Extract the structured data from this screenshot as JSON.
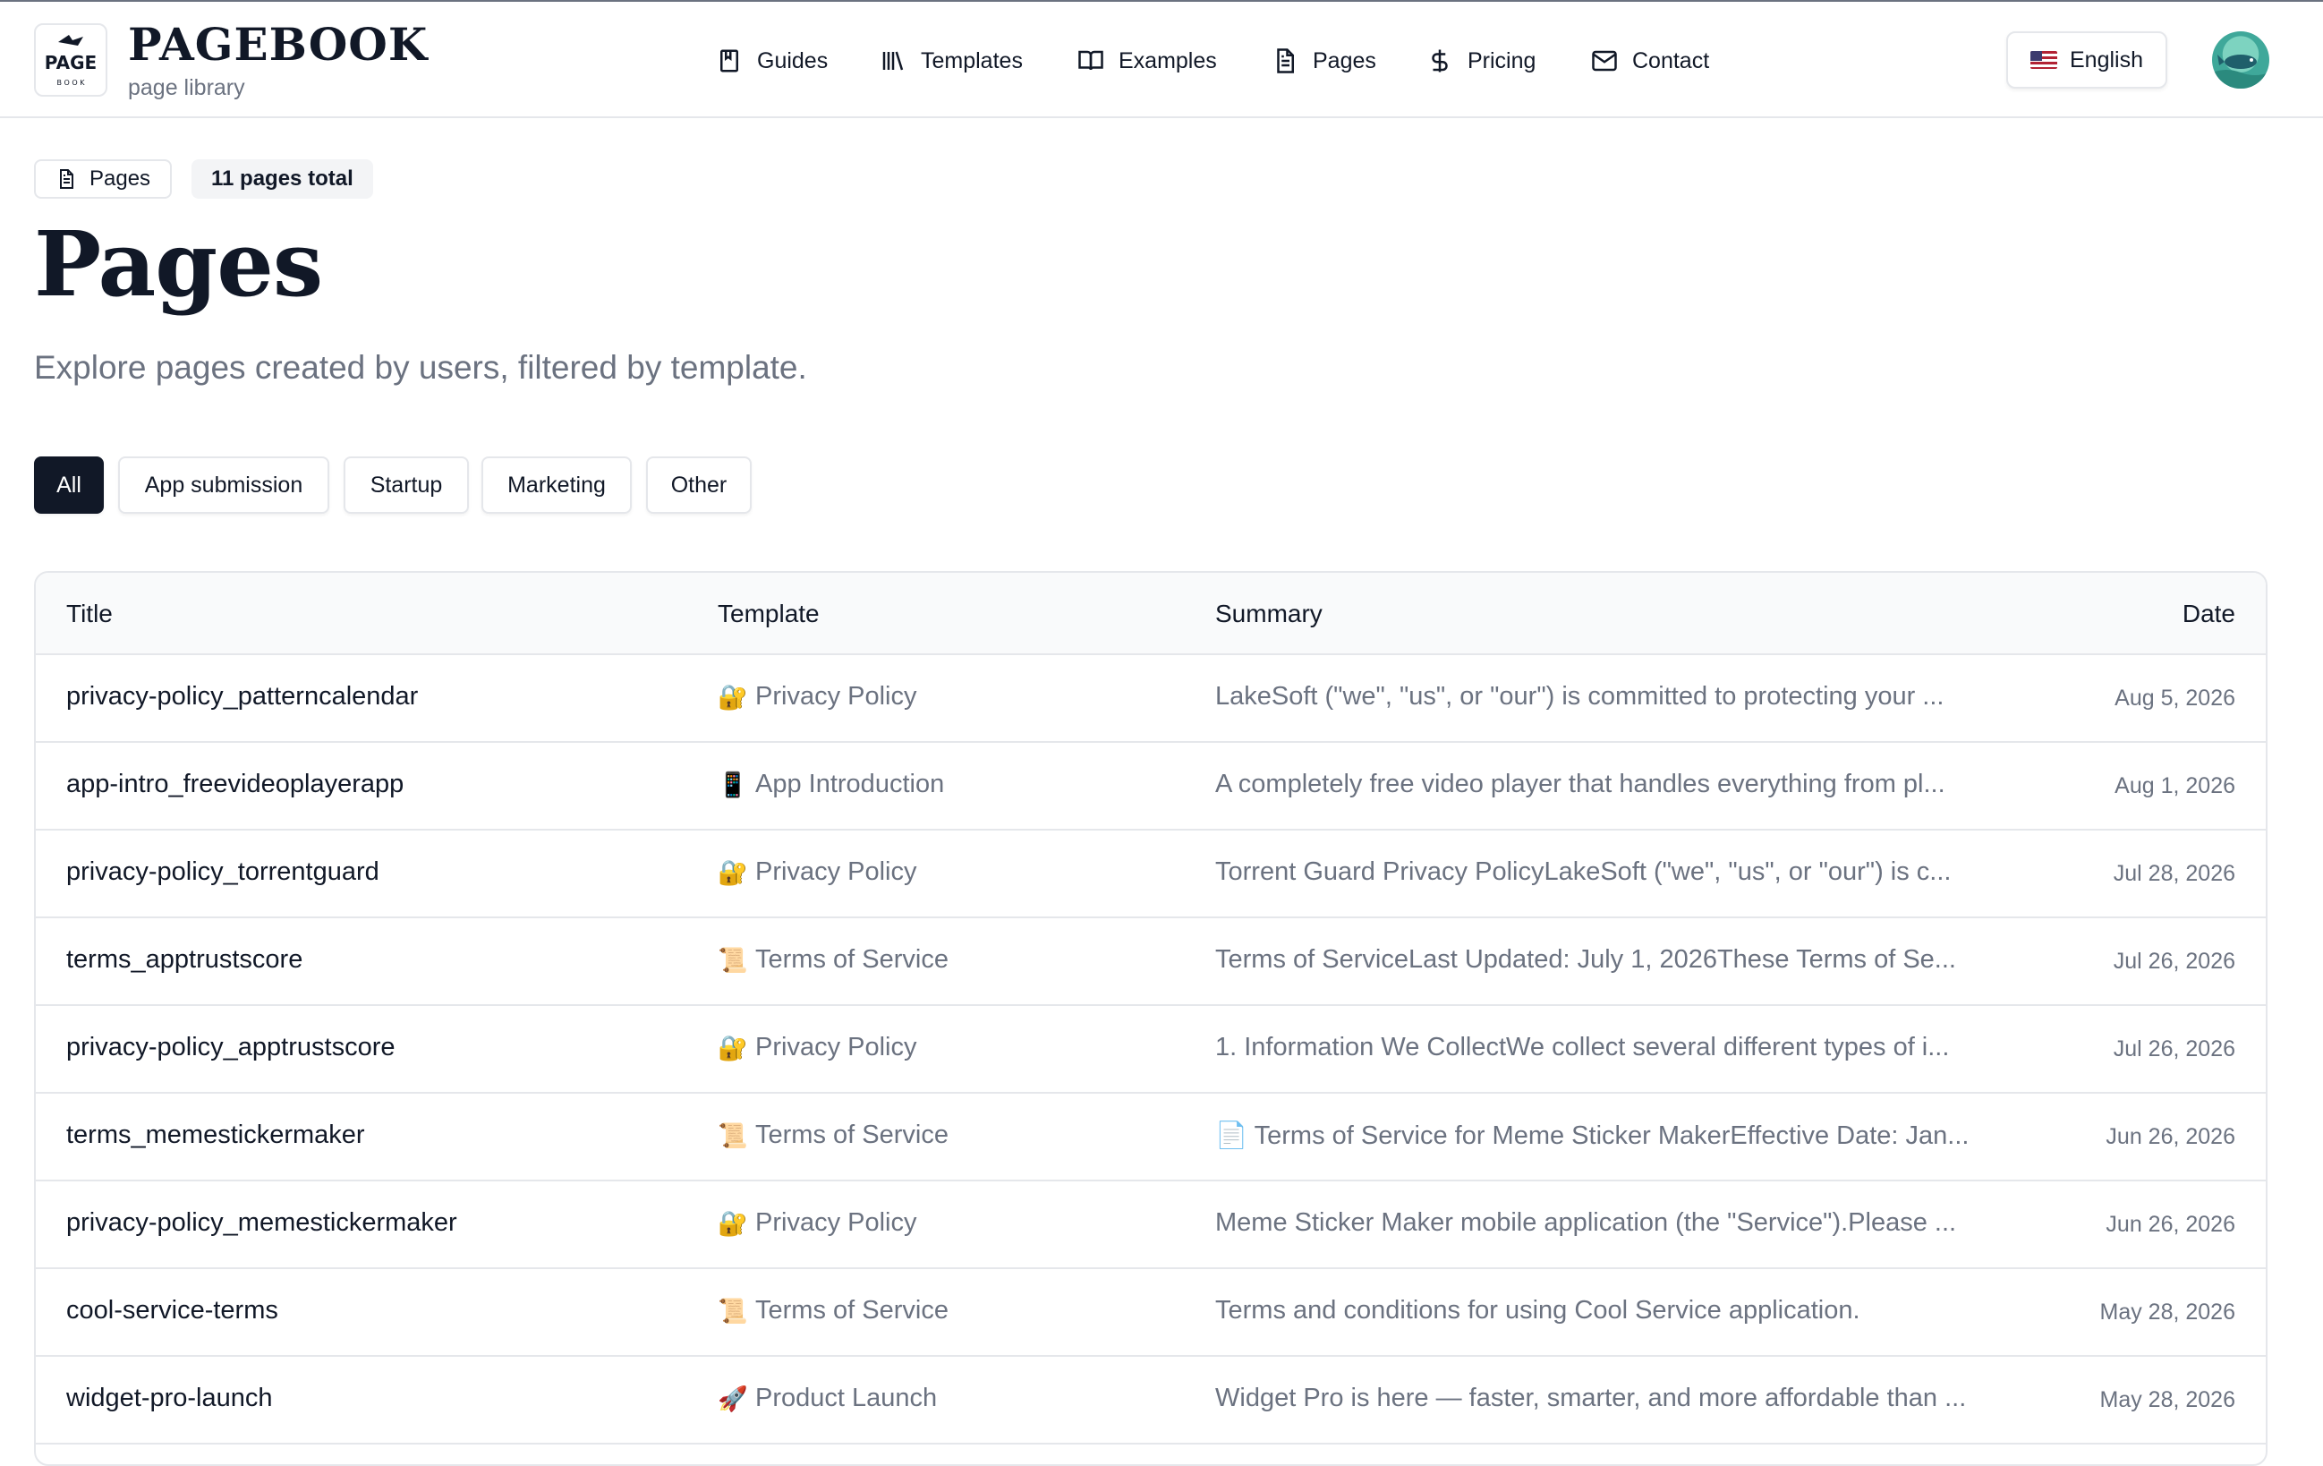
{
  "brand": {
    "name": "PAGEBOOK",
    "subtitle": "page library",
    "logo_text": "PAGE",
    "logo_small": "B O O K"
  },
  "nav": [
    {
      "label": "Guides",
      "icon": "guide-book-icon"
    },
    {
      "label": "Templates",
      "icon": "library-icon"
    },
    {
      "label": "Examples",
      "icon": "open-book-icon"
    },
    {
      "label": "Pages",
      "icon": "file-text-icon"
    },
    {
      "label": "Pricing",
      "icon": "dollar-icon"
    },
    {
      "label": "Contact",
      "icon": "mail-icon"
    }
  ],
  "language": {
    "label": "English",
    "flag": "us-flag-icon"
  },
  "chips": {
    "section": "Pages",
    "count": "11 pages total"
  },
  "page": {
    "title": "Pages",
    "subtitle": "Explore pages created by users, filtered by template."
  },
  "filters": [
    {
      "label": "All",
      "active": true
    },
    {
      "label": "App submission",
      "active": false
    },
    {
      "label": "Startup",
      "active": false
    },
    {
      "label": "Marketing",
      "active": false
    },
    {
      "label": "Other",
      "active": false
    }
  ],
  "table": {
    "headers": {
      "title": "Title",
      "template": "Template",
      "summary": "Summary",
      "date": "Date"
    },
    "rows": [
      {
        "title": "privacy-policy_patterncalendar",
        "template_icon": "🔐",
        "template": "Privacy Policy",
        "summary": "LakeSoft (\"we\", \"us\", or \"our\") is committed to protecting your ...",
        "date": "Aug 5, 2026"
      },
      {
        "title": "app-intro_freevideoplayerapp",
        "template_icon": "📱",
        "template": "App Introduction",
        "summary": "A completely free video player that handles everything from pl...",
        "date": "Aug 1, 2026"
      },
      {
        "title": "privacy-policy_torrentguard",
        "template_icon": "🔐",
        "template": "Privacy Policy",
        "summary": "Torrent Guard Privacy PolicyLakeSoft (\"we\", \"us\", or \"our\") is c...",
        "date": "Jul 28, 2026"
      },
      {
        "title": "terms_apptrustscore",
        "template_icon": "📜",
        "template": "Terms of Service",
        "summary": "Terms of ServiceLast Updated: July 1, 2026These Terms of Se...",
        "date": "Jul 26, 2026"
      },
      {
        "title": "privacy-policy_apptrustscore",
        "template_icon": "🔐",
        "template": "Privacy Policy",
        "summary": "1. Information We CollectWe collect several different types of i...",
        "date": "Jul 26, 2026"
      },
      {
        "title": "terms_memestickermaker",
        "template_icon": "📜",
        "template": "Terms of Service",
        "summary": "📄 Terms of Service for Meme Sticker MakerEffective Date: Jan...",
        "date": "Jun 26, 2026"
      },
      {
        "title": "privacy-policy_memestickermaker",
        "template_icon": "🔐",
        "template": "Privacy Policy",
        "summary": "Meme Sticker Maker mobile application (the \"Service\").Please ...",
        "date": "Jun 26, 2026"
      },
      {
        "title": "cool-service-terms",
        "template_icon": "📜",
        "template": "Terms of Service",
        "summary": "Terms and conditions for using Cool Service application.",
        "date": "May 28, 2026"
      },
      {
        "title": "widget-pro-launch",
        "template_icon": "🚀",
        "template": "Product Launch",
        "summary": "Widget Pro is here — faster, smarter, and more affordable than ...",
        "date": "May 28, 2026"
      }
    ]
  }
}
